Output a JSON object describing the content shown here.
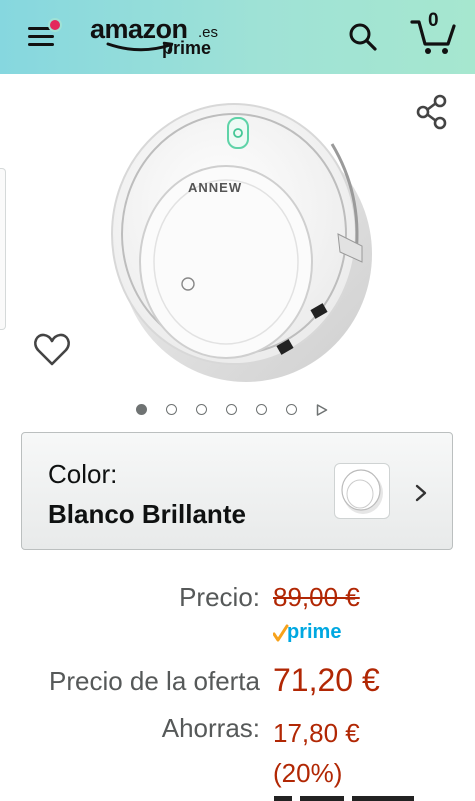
{
  "header": {
    "logo_word": "amazon",
    "logo_tld": ".es",
    "logo_sub": "prime",
    "cart_count": "0",
    "background": "#9fe2d6"
  },
  "product": {
    "brand_on_device": "ANNEW",
    "image_index": 1,
    "image_count": 6
  },
  "variation": {
    "label": "Color:",
    "value": "Blanco Brillante"
  },
  "pricing": {
    "list_label": "Precio:",
    "list_price": "89,00 €",
    "prime_label": "prime",
    "deal_label": "Precio de la oferta",
    "deal_price": "71,20 €",
    "savings_label": "Ahorras:",
    "savings_amount": "17,80 €",
    "savings_percent": "(20%)",
    "price_color": "#b12704",
    "prime_color": "#00a8e1"
  },
  "icons": {
    "menu": "menu-icon",
    "search": "search-icon",
    "cart": "cart-icon",
    "share": "share-icon",
    "wishlist": "heart-icon",
    "chevron": "chevron-right-icon"
  }
}
